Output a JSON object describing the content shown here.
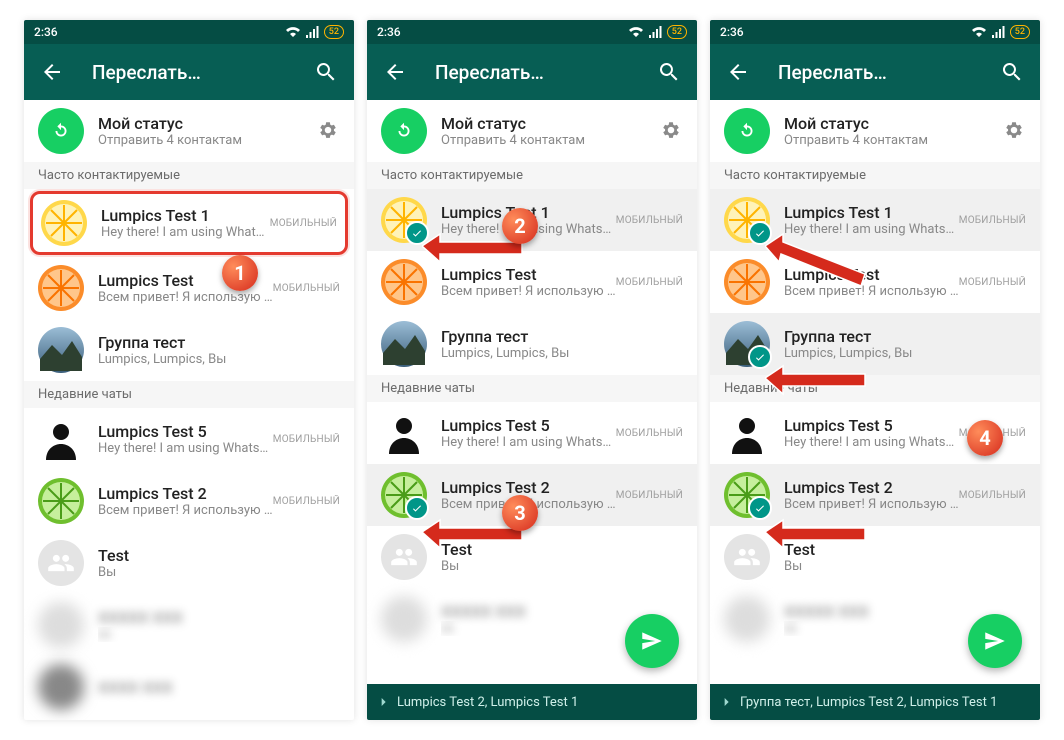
{
  "status": {
    "time": "2:36",
    "battery": "52"
  },
  "header": {
    "title": "Переслать…"
  },
  "mystatus": {
    "title": "Мой статус",
    "sub": "Отправить 4 контактам"
  },
  "sections": {
    "frequent": "Часто контактируемые",
    "recent": "Недавние чаты"
  },
  "contacts": {
    "c1": {
      "name": "Lumpics Test 1",
      "sub": "Hey there! I am using WhatsApp.",
      "tag": "МОБИЛЬНЫЙ"
    },
    "c2": {
      "name": "Lumpics Test",
      "sub": "Всем привет! Я использую WhatsApp.",
      "tag": "МОБИЛЬНЫЙ"
    },
    "c3": {
      "name": "Группа тест",
      "sub": "Lumpics, Lumpics, Вы"
    },
    "c4": {
      "name": "Lumpics Test 5",
      "sub": "Hey there! I am using WhatsApp.",
      "tag": "МОБИЛЬНЫЙ"
    },
    "c5": {
      "name": "Lumpics Test 2",
      "sub": "Всем привет! Я использую WhatsApp.",
      "tag": "МОБИЛЬНЫЙ"
    },
    "c6": {
      "name": "Test",
      "sub": "Вы"
    }
  },
  "selbar": {
    "s2": "Lumpics Test 2, Lumpics Test 1",
    "s3": "Группа тест, Lumpics Test 2, Lumpics Test 1"
  },
  "steps": {
    "n1": "1",
    "n2": "2",
    "n3": "3",
    "n4": "4"
  }
}
